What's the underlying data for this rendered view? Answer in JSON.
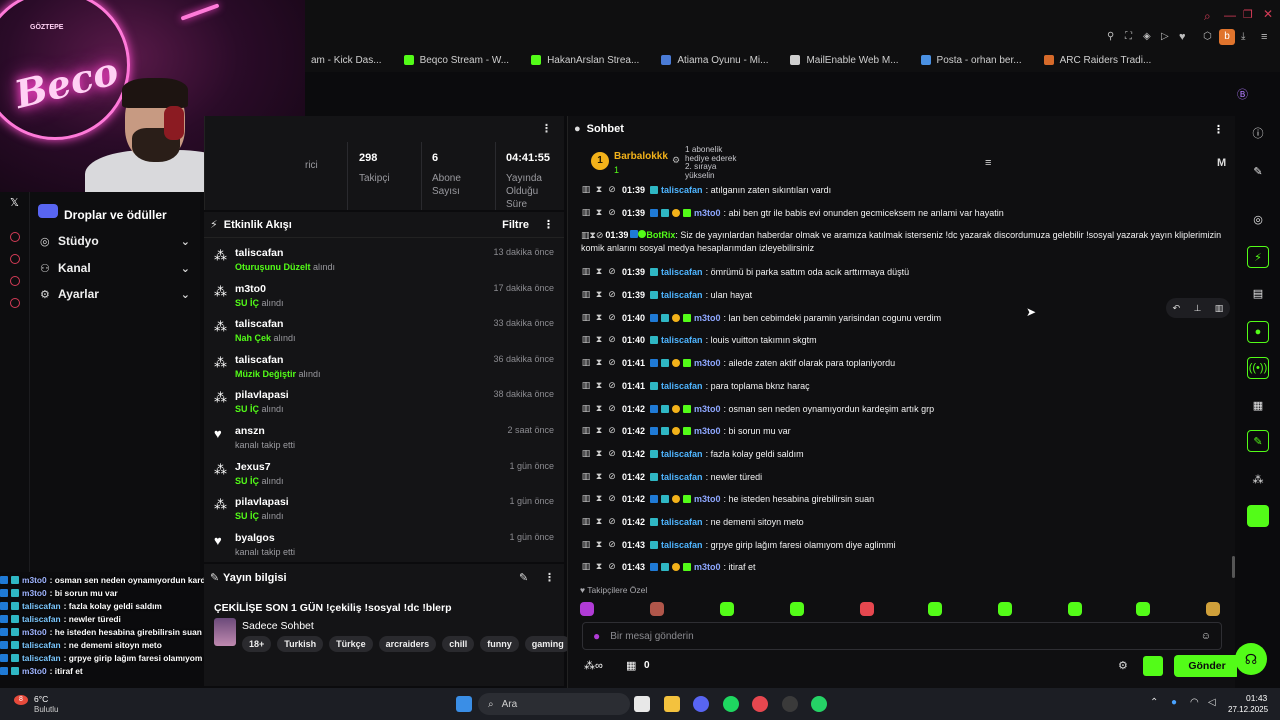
{
  "bookmarks": [
    {
      "label": "am - Kick Das...",
      "color": "#53fc18"
    },
    {
      "label": "Beqco Stream - W...",
      "color": "#53fc18"
    },
    {
      "label": "HakanArslan Strea...",
      "color": "#53fc18"
    },
    {
      "label": "Atiama Oyunu - Mi...",
      "color": "#4a7bd6"
    },
    {
      "label": "MailEnable Web M...",
      "color": "#cfcfcf"
    },
    {
      "label": "Posta - orhan ber...",
      "color": "#4a90e2"
    },
    {
      "label": "ARC Raiders Tradi...",
      "color": "#d66a2a"
    }
  ],
  "webcam": {
    "sign_top": "GÖZTEPE",
    "sign_main": "Beco"
  },
  "left_menu": {
    "drops": "Droplar ve ödüller",
    "studio": "Stüdyo",
    "channel": "Kanal",
    "settings": "Ayarlar"
  },
  "stats": [
    {
      "value": "",
      "label": "rici"
    },
    {
      "value": "298",
      "label": "Takipçi"
    },
    {
      "value": "6",
      "label": "Abone Sayısı"
    },
    {
      "value": "04:41:55",
      "label": "Yayında Olduğu Süre"
    }
  ],
  "feed": {
    "title": "Etkinlik Akışı",
    "filter": "Filtre",
    "suffix_received": "alındı",
    "items": [
      {
        "user": "taliscafan",
        "item": "Oturuşunu Düzelt",
        "sub": "alındı",
        "time": "13 dakika önce",
        "icon": "reward-icon"
      },
      {
        "user": "m3to0",
        "item": "SU İÇ",
        "sub": "alındı",
        "time": "17 dakika önce",
        "icon": "reward-icon"
      },
      {
        "user": "taliscafan",
        "item": "Nah Çek",
        "sub": "alındı",
        "time": "33 dakika önce",
        "icon": "reward-icon"
      },
      {
        "user": "taliscafan",
        "item": "Müzik Değiştir",
        "sub": "alındı",
        "time": "36 dakika önce",
        "icon": "reward-icon"
      },
      {
        "user": "pilavlapasi",
        "item": "SU İÇ",
        "sub": "alındı",
        "time": "38 dakika önce",
        "icon": "reward-icon"
      },
      {
        "user": "anszn",
        "item": "",
        "sub": "kanalı takip etti",
        "time": "2 saat önce",
        "icon": "heart-icon"
      },
      {
        "user": "Jexus7",
        "item": "SU İÇ",
        "sub": "alındı",
        "time": "1 gün önce",
        "icon": "reward-icon"
      },
      {
        "user": "pilavlapasi",
        "item": "SU İÇ",
        "sub": "alındı",
        "time": "1 gün önce",
        "icon": "reward-icon"
      },
      {
        "user": "byalgos",
        "item": "",
        "sub": "kanalı takip etti",
        "time": "1 gün önce",
        "icon": "heart-icon"
      }
    ]
  },
  "stream_info": {
    "title": "Yayın bilgisi",
    "stream_title": "ÇEKİLİŞE SON 1 GÜN !çekiliş !sosyal !dc !blerp",
    "category": "Sadece Sohbet",
    "tags": [
      "18+",
      "Turkish",
      "Türkçe",
      "arcraiders",
      "chill",
      "funny",
      "gaming"
    ]
  },
  "chat": {
    "title": "Sohbet",
    "pinned": {
      "user": "Barbalokkk",
      "count": "1",
      "text1": "1 abonelik",
      "text2": "hediye ederek",
      "text3": "2. sıraya",
      "text4": "yükselin",
      "badge": "1"
    },
    "messages": [
      {
        "time": "01:39",
        "user": "taliscafan",
        "text": ": atılganın zaten sıkıntıları vardı",
        "style": "t"
      },
      {
        "time": "01:39",
        "user": "m3to0",
        "text": ": abi ben gtr ile babis evi onunden gecmiceksem ne anlami var hayatin",
        "style": "m"
      },
      {
        "time": "01:39",
        "user": "BotRix",
        "text": ": Siz de yayınlardan haberdar olmak ve aramıza katılmak isterseniz !dc yazarak discordumuza gelebilir !sosyal yazarak yayın kliplerimizin komik anlarını sosyal medya hesaplarımdan izleyebilirsiniz",
        "style": "b"
      },
      {
        "time": "01:39",
        "user": "taliscafan",
        "text": ": ömrümü bi parka sattım oda acık arttırmaya düştü",
        "style": "t"
      },
      {
        "time": "01:39",
        "user": "taliscafan",
        "text": ": ulan hayat",
        "style": "t"
      },
      {
        "time": "01:40",
        "user": "m3to0",
        "text": ": lan ben cebimdeki paramin yarisindan cogunu verdim",
        "style": "m"
      },
      {
        "time": "01:40",
        "user": "taliscafan",
        "text": ": louis vuitton takımın skgtm",
        "style": "t"
      },
      {
        "time": "01:41",
        "user": "m3to0",
        "text": ": ailede zaten aktif olarak para toplaniyordu",
        "style": "m"
      },
      {
        "time": "01:41",
        "user": "taliscafan",
        "text": ": para toplama bknz haraç",
        "style": "t"
      },
      {
        "time": "01:42",
        "user": "m3to0",
        "text": ": osman sen neden oynamıyordun kardeşim artık grp",
        "style": "m"
      },
      {
        "time": "01:42",
        "user": "m3to0",
        "text": ": bi sorun mu var",
        "style": "m"
      },
      {
        "time": "01:42",
        "user": "taliscafan",
        "text": ": fazla kolay geldi saldım",
        "style": "t"
      },
      {
        "time": "01:42",
        "user": "taliscafan",
        "text": ": newler türedi",
        "style": "t"
      },
      {
        "time": "01:42",
        "user": "m3to0",
        "text": ": he isteden hesabina girebilirsin suan",
        "style": "m"
      },
      {
        "time": "01:42",
        "user": "taliscafan",
        "text": ": ne dememi sitoyn meto",
        "style": "t"
      },
      {
        "time": "01:43",
        "user": "taliscafan",
        "text": ": grpye girip lağım faresi olamıyom diye aglimmi",
        "style": "t"
      },
      {
        "time": "01:43",
        "user": "m3to0",
        "text": ": itiraf et",
        "style": "m"
      }
    ],
    "followers_only": "Takipçilere Özel",
    "input_placeholder": "Bir mesaj gönderin",
    "points": "0",
    "send": "Gönder"
  },
  "overlay_lines": [
    {
      "user": "m3to0",
      "text": ": osman sen neden oynamıyordun kardeşim artık grp"
    },
    {
      "user": "m3to0",
      "text": ": bi sorun mu var"
    },
    {
      "user": "taliscafan",
      "text": ": fazla kolay geldi saldım"
    },
    {
      "user": "taliscafan",
      "text": ": newler türedi"
    },
    {
      "user": "m3to0",
      "text": ": he isteden hesabina girebilirsin suan"
    },
    {
      "user": "taliscafan",
      "text": ": ne dememi sitoyn meto"
    },
    {
      "user": "taliscafan",
      "text": ": grpye girip lağım faresi olamıyom diye aglimmi"
    },
    {
      "user": "m3to0",
      "text": ": itiraf et"
    }
  ],
  "taskbar": {
    "weather_temp": "6°C",
    "weather_desc": "Bulutlu",
    "weather_badge": "8",
    "search": "Ara",
    "clock_time": "01:43",
    "clock_date": "27.12.2025"
  },
  "colors": {
    "accent": "#53fc18",
    "bg": "#0f0f11",
    "panel": "#141416"
  }
}
